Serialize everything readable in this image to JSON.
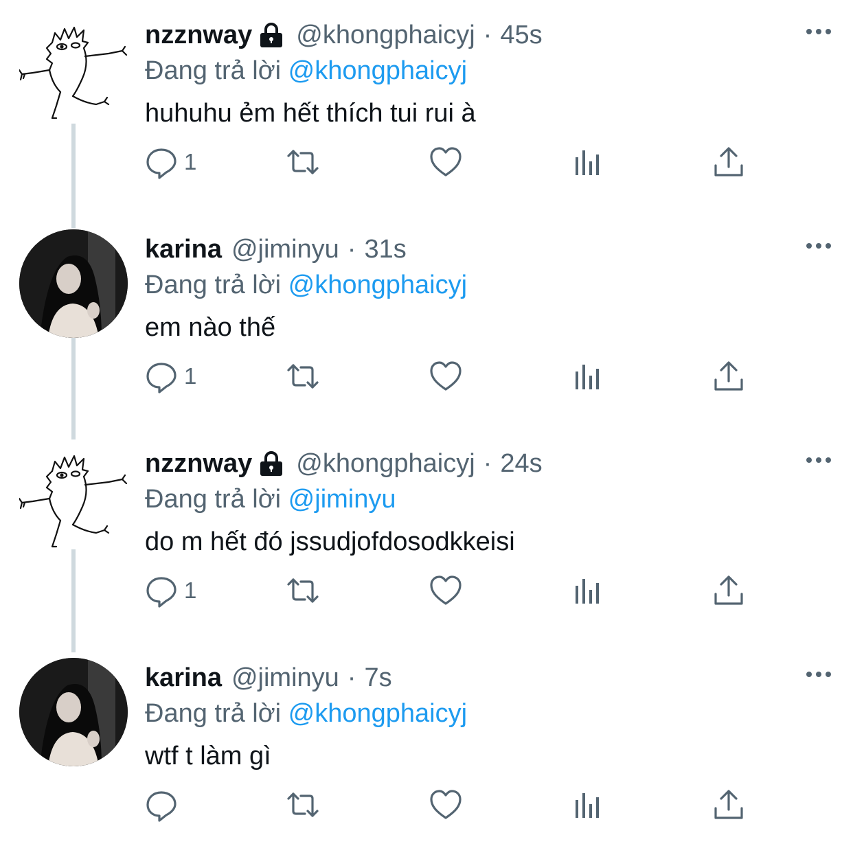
{
  "reply_prefix": "Đang trả lời",
  "colors": {
    "accent": "#1d9bf0",
    "secondary_text": "#536471",
    "thread_line": "#cfd9de"
  },
  "tweets": [
    {
      "name": "nzznway",
      "locked": true,
      "handle": "@khongphaicyj",
      "time": "45s",
      "replying_to": "@khongphaicyj",
      "text": "huhuhu ẻm hết thích tui rui à",
      "reply_count": "1",
      "avatar": "doodle-drawing"
    },
    {
      "name": "karina",
      "locked": false,
      "handle": "@jiminyu",
      "time": "31s",
      "replying_to": "@khongphaicyj",
      "text": "em nào thế",
      "reply_count": "1",
      "avatar": "photo"
    },
    {
      "name": "nzznway",
      "locked": true,
      "handle": "@khongphaicyj",
      "time": "24s",
      "replying_to": "@jiminyu",
      "text": "do m hết đó jssudjofdosodkkeisi",
      "reply_count": "1",
      "avatar": "doodle-drawing"
    },
    {
      "name": "karina",
      "locked": false,
      "handle": "@jiminyu",
      "time": "7s",
      "replying_to": "@khongphaicyj",
      "text": "wtf t làm gì",
      "reply_count": "",
      "avatar": "photo"
    }
  ]
}
